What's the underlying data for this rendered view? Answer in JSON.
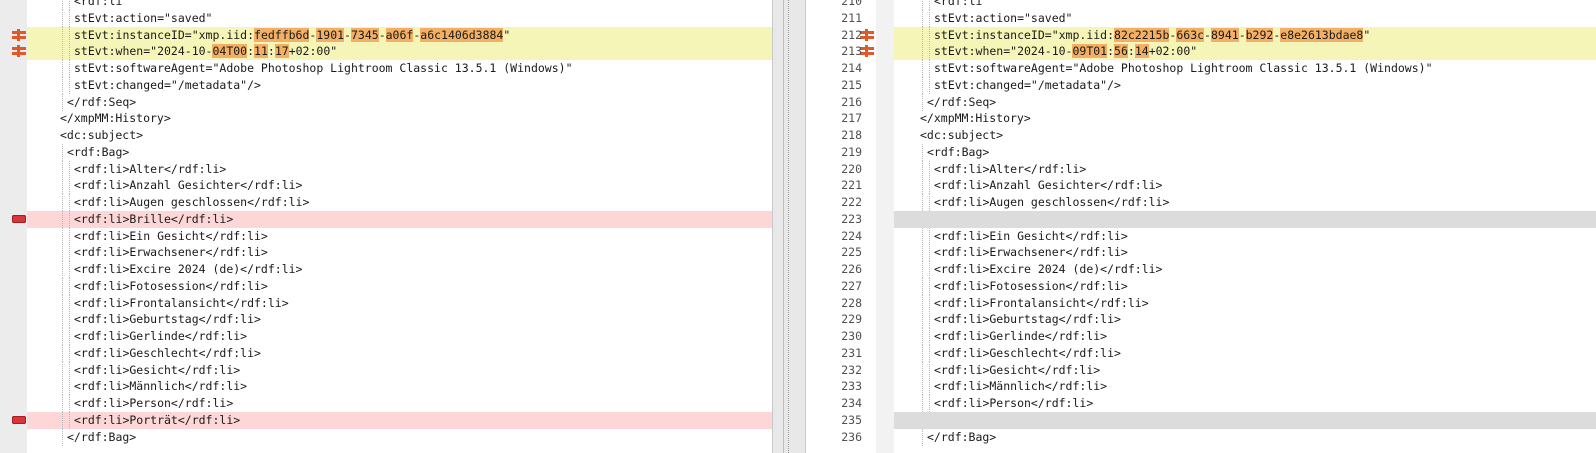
{
  "left": {
    "lines": [
      {
        "kind": "normal",
        "marker": "",
        "segments": [
          {
            "t": "<rdf:li"
          }
        ]
      },
      {
        "kind": "normal",
        "marker": "",
        "segments": [
          {
            "t": "stEvt:action=\"saved\""
          }
        ]
      },
      {
        "kind": "changed",
        "marker": "change",
        "segments": [
          {
            "t": "stEvt:instanceID=\"xmp.iid:"
          },
          {
            "t": "fedffb6d",
            "h": true
          },
          {
            "t": "-"
          },
          {
            "t": "1901",
            "h": true
          },
          {
            "t": "-"
          },
          {
            "t": "7345",
            "h": true
          },
          {
            "t": "-"
          },
          {
            "t": "a06f",
            "h": true
          },
          {
            "t": "-"
          },
          {
            "t": "a6c1406d3884",
            "h": true
          },
          {
            "t": "\""
          }
        ]
      },
      {
        "kind": "changed",
        "marker": "change",
        "segments": [
          {
            "t": "stEvt:when=\"2024-10-"
          },
          {
            "t": "04T00",
            "h": true
          },
          {
            "t": ":"
          },
          {
            "t": "11",
            "h": true
          },
          {
            "t": ":"
          },
          {
            "t": "17",
            "h": true
          },
          {
            "t": "+02:00\""
          }
        ]
      },
      {
        "kind": "normal",
        "marker": "",
        "segments": [
          {
            "t": "stEvt:softwareAgent=\"Adobe Photoshop Lightroom Classic 13.5.1 (Windows)\""
          }
        ]
      },
      {
        "kind": "normal",
        "marker": "",
        "segments": [
          {
            "t": "stEvt:changed=\"/metadata\"/>"
          }
        ]
      },
      {
        "kind": "normal",
        "marker": "",
        "segments": [
          {
            "t": "</rdf:Seq>"
          }
        ]
      },
      {
        "kind": "normal",
        "marker": "",
        "segments": [
          {
            "t": "</xmpMM:History>"
          }
        ]
      },
      {
        "kind": "normal",
        "marker": "",
        "segments": [
          {
            "t": "<dc:subject>"
          }
        ]
      },
      {
        "kind": "normal",
        "marker": "",
        "segments": [
          {
            "t": "<rdf:Bag>"
          }
        ]
      },
      {
        "kind": "normal",
        "marker": "",
        "segments": [
          {
            "t": "<rdf:li>Alter</rdf:li>"
          }
        ]
      },
      {
        "kind": "normal",
        "marker": "",
        "segments": [
          {
            "t": "<rdf:li>Anzahl Gesichter</rdf:li>"
          }
        ]
      },
      {
        "kind": "normal",
        "marker": "",
        "segments": [
          {
            "t": "<rdf:li>Augen geschlossen</rdf:li>"
          }
        ]
      },
      {
        "kind": "deleted",
        "marker": "delete",
        "segments": [
          {
            "t": "<rdf:li>Brille</rdf:li>"
          }
        ]
      },
      {
        "kind": "normal",
        "marker": "",
        "segments": [
          {
            "t": "<rdf:li>Ein Gesicht</rdf:li>"
          }
        ]
      },
      {
        "kind": "normal",
        "marker": "",
        "segments": [
          {
            "t": "<rdf:li>Erwachsener</rdf:li>"
          }
        ]
      },
      {
        "kind": "normal",
        "marker": "",
        "segments": [
          {
            "t": "<rdf:li>Excire 2024 (de)</rdf:li>"
          }
        ]
      },
      {
        "kind": "normal",
        "marker": "",
        "segments": [
          {
            "t": "<rdf:li>Fotosession</rdf:li>"
          }
        ]
      },
      {
        "kind": "normal",
        "marker": "",
        "segments": [
          {
            "t": "<rdf:li>Frontalansicht</rdf:li>"
          }
        ]
      },
      {
        "kind": "normal",
        "marker": "",
        "segments": [
          {
            "t": "<rdf:li>Geburtstag</rdf:li>"
          }
        ]
      },
      {
        "kind": "normal",
        "marker": "",
        "segments": [
          {
            "t": "<rdf:li>Gerlinde</rdf:li>"
          }
        ]
      },
      {
        "kind": "normal",
        "marker": "",
        "segments": [
          {
            "t": "<rdf:li>Geschlecht</rdf:li>"
          }
        ]
      },
      {
        "kind": "normal",
        "marker": "",
        "segments": [
          {
            "t": "<rdf:li>Gesicht</rdf:li>"
          }
        ]
      },
      {
        "kind": "normal",
        "marker": "",
        "segments": [
          {
            "t": "<rdf:li>Männlich</rdf:li>"
          }
        ]
      },
      {
        "kind": "normal",
        "marker": "",
        "segments": [
          {
            "t": "<rdf:li>Person</rdf:li>"
          }
        ]
      },
      {
        "kind": "deleted",
        "marker": "delete",
        "segments": [
          {
            "t": "<rdf:li>Porträt</rdf:li>"
          }
        ]
      },
      {
        "kind": "normal",
        "marker": "",
        "segments": [
          {
            "t": "</rdf:Bag>"
          }
        ]
      }
    ]
  },
  "right": {
    "lines": [
      {
        "num": "210",
        "kind": "normal",
        "marker": "",
        "segments": [
          {
            "t": "<rdf:li"
          }
        ]
      },
      {
        "num": "211",
        "kind": "normal",
        "marker": "",
        "segments": [
          {
            "t": "stEvt:action=\"saved\""
          }
        ]
      },
      {
        "num": "212",
        "kind": "changed",
        "marker": "change",
        "segments": [
          {
            "t": "stEvt:instanceID=\"xmp.iid:"
          },
          {
            "t": "82c2215b",
            "h": true
          },
          {
            "t": "-"
          },
          {
            "t": "663c",
            "h": true
          },
          {
            "t": "-"
          },
          {
            "t": "8941",
            "h": true
          },
          {
            "t": "-"
          },
          {
            "t": "b292",
            "h": true
          },
          {
            "t": "-"
          },
          {
            "t": "e8e2613bdae8",
            "h": true
          },
          {
            "t": "\""
          }
        ]
      },
      {
        "num": "213",
        "kind": "changed",
        "marker": "change",
        "segments": [
          {
            "t": "stEvt:when=\"2024-10-"
          },
          {
            "t": "09T01",
            "h": true
          },
          {
            "t": ":"
          },
          {
            "t": "56",
            "h": true
          },
          {
            "t": ":"
          },
          {
            "t": "14",
            "h": true
          },
          {
            "t": "+02:00\""
          }
        ]
      },
      {
        "num": "214",
        "kind": "normal",
        "marker": "",
        "segments": [
          {
            "t": "stEvt:softwareAgent=\"Adobe Photoshop Lightroom Classic 13.5.1 (Windows)\""
          }
        ]
      },
      {
        "num": "215",
        "kind": "normal",
        "marker": "",
        "segments": [
          {
            "t": "stEvt:changed=\"/metadata\"/>"
          }
        ]
      },
      {
        "num": "216",
        "kind": "normal",
        "marker": "",
        "segments": [
          {
            "t": "</rdf:Seq>"
          }
        ]
      },
      {
        "num": "217",
        "kind": "normal",
        "marker": "",
        "segments": [
          {
            "t": "</xmpMM:History>"
          }
        ]
      },
      {
        "num": "218",
        "kind": "normal",
        "marker": "",
        "segments": [
          {
            "t": "<dc:subject>"
          }
        ]
      },
      {
        "num": "219",
        "kind": "normal",
        "marker": "",
        "segments": [
          {
            "t": "<rdf:Bag>"
          }
        ]
      },
      {
        "num": "220",
        "kind": "normal",
        "marker": "",
        "segments": [
          {
            "t": "<rdf:li>Alter</rdf:li>"
          }
        ]
      },
      {
        "num": "221",
        "kind": "normal",
        "marker": "",
        "segments": [
          {
            "t": "<rdf:li>Anzahl Gesichter</rdf:li>"
          }
        ]
      },
      {
        "num": "222",
        "kind": "normal",
        "marker": "",
        "segments": [
          {
            "t": "<rdf:li>Augen geschlossen</rdf:li>"
          }
        ]
      },
      {
        "num": "223",
        "kind": "empty",
        "marker": "",
        "segments": []
      },
      {
        "num": "224",
        "kind": "normal",
        "marker": "",
        "segments": [
          {
            "t": "<rdf:li>Ein Gesicht</rdf:li>"
          }
        ]
      },
      {
        "num": "225",
        "kind": "normal",
        "marker": "",
        "segments": [
          {
            "t": "<rdf:li>Erwachsener</rdf:li>"
          }
        ]
      },
      {
        "num": "226",
        "kind": "normal",
        "marker": "",
        "segments": [
          {
            "t": "<rdf:li>Excire 2024 (de)</rdf:li>"
          }
        ]
      },
      {
        "num": "227",
        "kind": "normal",
        "marker": "",
        "segments": [
          {
            "t": "<rdf:li>Fotosession</rdf:li>"
          }
        ]
      },
      {
        "num": "228",
        "kind": "normal",
        "marker": "",
        "segments": [
          {
            "t": "<rdf:li>Frontalansicht</rdf:li>"
          }
        ]
      },
      {
        "num": "229",
        "kind": "normal",
        "marker": "",
        "segments": [
          {
            "t": "<rdf:li>Geburtstag</rdf:li>"
          }
        ]
      },
      {
        "num": "230",
        "kind": "normal",
        "marker": "",
        "segments": [
          {
            "t": "<rdf:li>Gerlinde</rdf:li>"
          }
        ]
      },
      {
        "num": "231",
        "kind": "normal",
        "marker": "",
        "segments": [
          {
            "t": "<rdf:li>Geschlecht</rdf:li>"
          }
        ]
      },
      {
        "num": "232",
        "kind": "normal",
        "marker": "",
        "segments": [
          {
            "t": "<rdf:li>Gesicht</rdf:li>"
          }
        ]
      },
      {
        "num": "233",
        "kind": "normal",
        "marker": "",
        "segments": [
          {
            "t": "<rdf:li>Männlich</rdf:li>"
          }
        ]
      },
      {
        "num": "234",
        "kind": "normal",
        "marker": "",
        "segments": [
          {
            "t": "<rdf:li>Person</rdf:li>"
          }
        ]
      },
      {
        "num": "235",
        "kind": "empty",
        "marker": "",
        "segments": []
      },
      {
        "num": "236",
        "kind": "normal",
        "marker": "",
        "segments": [
          {
            "t": "</rdf:Bag>"
          }
        ]
      }
    ]
  },
  "colors": {
    "changed_line": "#f5f5b8",
    "deleted_line": "#fdd7d7",
    "empty_line": "#dcdcdc",
    "inline_highlight": "#f3b064",
    "delete_marker": "#d7363b",
    "change_marker": "#e0592a"
  },
  "icons": {
    "delete_marker": "minus-marker-icon",
    "change_marker": "change-marker-icon"
  }
}
